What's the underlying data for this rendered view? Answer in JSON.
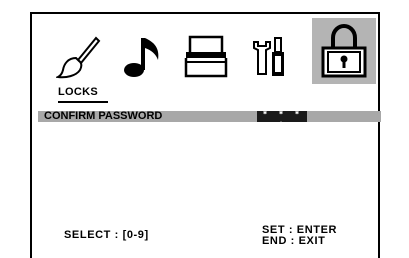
{
  "tabs": [
    {
      "icon": "paintbrush-icon",
      "active": false
    },
    {
      "icon": "music-note-icon",
      "active": false
    },
    {
      "icon": "tv-screen-icon",
      "active": false
    },
    {
      "icon": "tools-icon",
      "active": false
    },
    {
      "icon": "padlock-icon",
      "active": true
    }
  ],
  "section": {
    "title": "LOCKS"
  },
  "menu": {
    "item_label": "CONFIRM PASSWORD",
    "password_value": "* * * *"
  },
  "footer": {
    "select_hint": "SELECT : [0-9]",
    "set_hint": "SET : ENTER",
    "end_hint": "END : EXIT"
  },
  "colors": {
    "highlight_bar": "#a8a8a8",
    "active_tab": "#b4b4b4",
    "field_bg": "#1a1a1a"
  }
}
